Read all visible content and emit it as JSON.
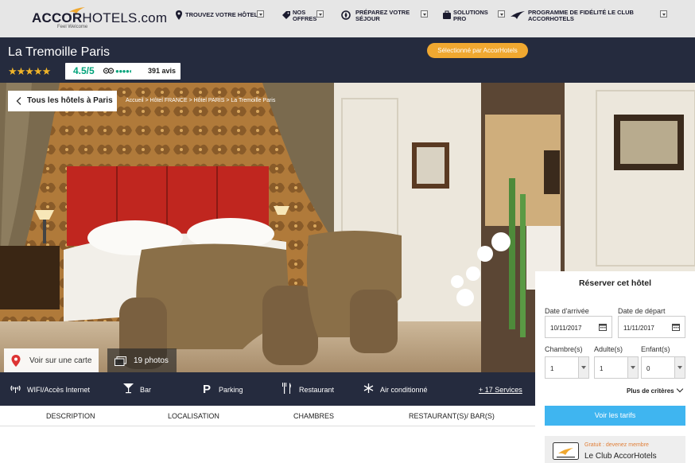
{
  "brand": {
    "logo_main": "ACCOR",
    "logo_secondary": "HOTELS",
    "logo_suffix": ".com",
    "tagline": "Feel Welcome"
  },
  "nav": {
    "items": [
      {
        "label_line1": "Trouvez votre hôtel",
        "label_line2": "",
        "icon": "pin-icon"
      },
      {
        "label_line1": "Nos",
        "label_line2": "offres",
        "icon": "tag-icon"
      },
      {
        "label_line1": "Préparez votre",
        "label_line2": "séjour",
        "icon": "compass-icon"
      },
      {
        "label_line1": "Solutions",
        "label_line2": "pro",
        "icon": "briefcase-icon"
      },
      {
        "label_line1": "Programme de fidélité Le Club",
        "label_line2": "AccorHotels",
        "icon": "loyalty-bird-icon"
      }
    ]
  },
  "hotel": {
    "name": "La Tremoille Paris",
    "stars": "★★★★★",
    "rating_score": "4.5/5",
    "rating_dots": "●●●●◐",
    "rating_count": "391 avis",
    "badge": "Sélectionné par AccorHotels"
  },
  "hero": {
    "back_label": "Tous les hôtels à Paris",
    "breadcrumb": "Accueil > Hôtel FRANCE > Hôtel PARIS > La Tremoille Paris",
    "map_label": "Voir sur une carte",
    "photos_label": "19 photos"
  },
  "amenities": {
    "items": [
      {
        "label": "WIFI/Accès Internet",
        "icon": "wifi-icon"
      },
      {
        "label": "Bar",
        "icon": "cocktail-icon"
      },
      {
        "label": "Parking",
        "icon": "parking-icon"
      },
      {
        "label": "Restaurant",
        "icon": "cutlery-icon"
      },
      {
        "label": "Air conditionné",
        "icon": "snowflake-icon"
      }
    ],
    "more": "+ 17 Services"
  },
  "tabs": [
    "Description",
    "Localisation",
    "Chambres",
    "Restaurant(s)/ Bar(s)"
  ],
  "booking": {
    "title": "Réserver cet hôtel",
    "arrival_label": "Date d'arrivée",
    "arrival_value": "10/11/2017",
    "departure_label": "Date de départ",
    "departure_value": "11/11/2017",
    "rooms_label": "Chambre(s)",
    "rooms_value": "1",
    "adults_label": "Adulte(s)",
    "adults_value": "1",
    "children_label": "Enfant(s)",
    "children_value": "0",
    "more_criteria": "Plus de critères",
    "cta": "Voir les tarifs",
    "club_free": "Gratuit : devenez membre",
    "club_name": "Le Club AccorHotels"
  },
  "colors": {
    "navy": "#252b3e",
    "accent_orange": "#f0a830",
    "cta_blue": "#3fb5f0",
    "tripadvisor_green": "#00a37a"
  }
}
